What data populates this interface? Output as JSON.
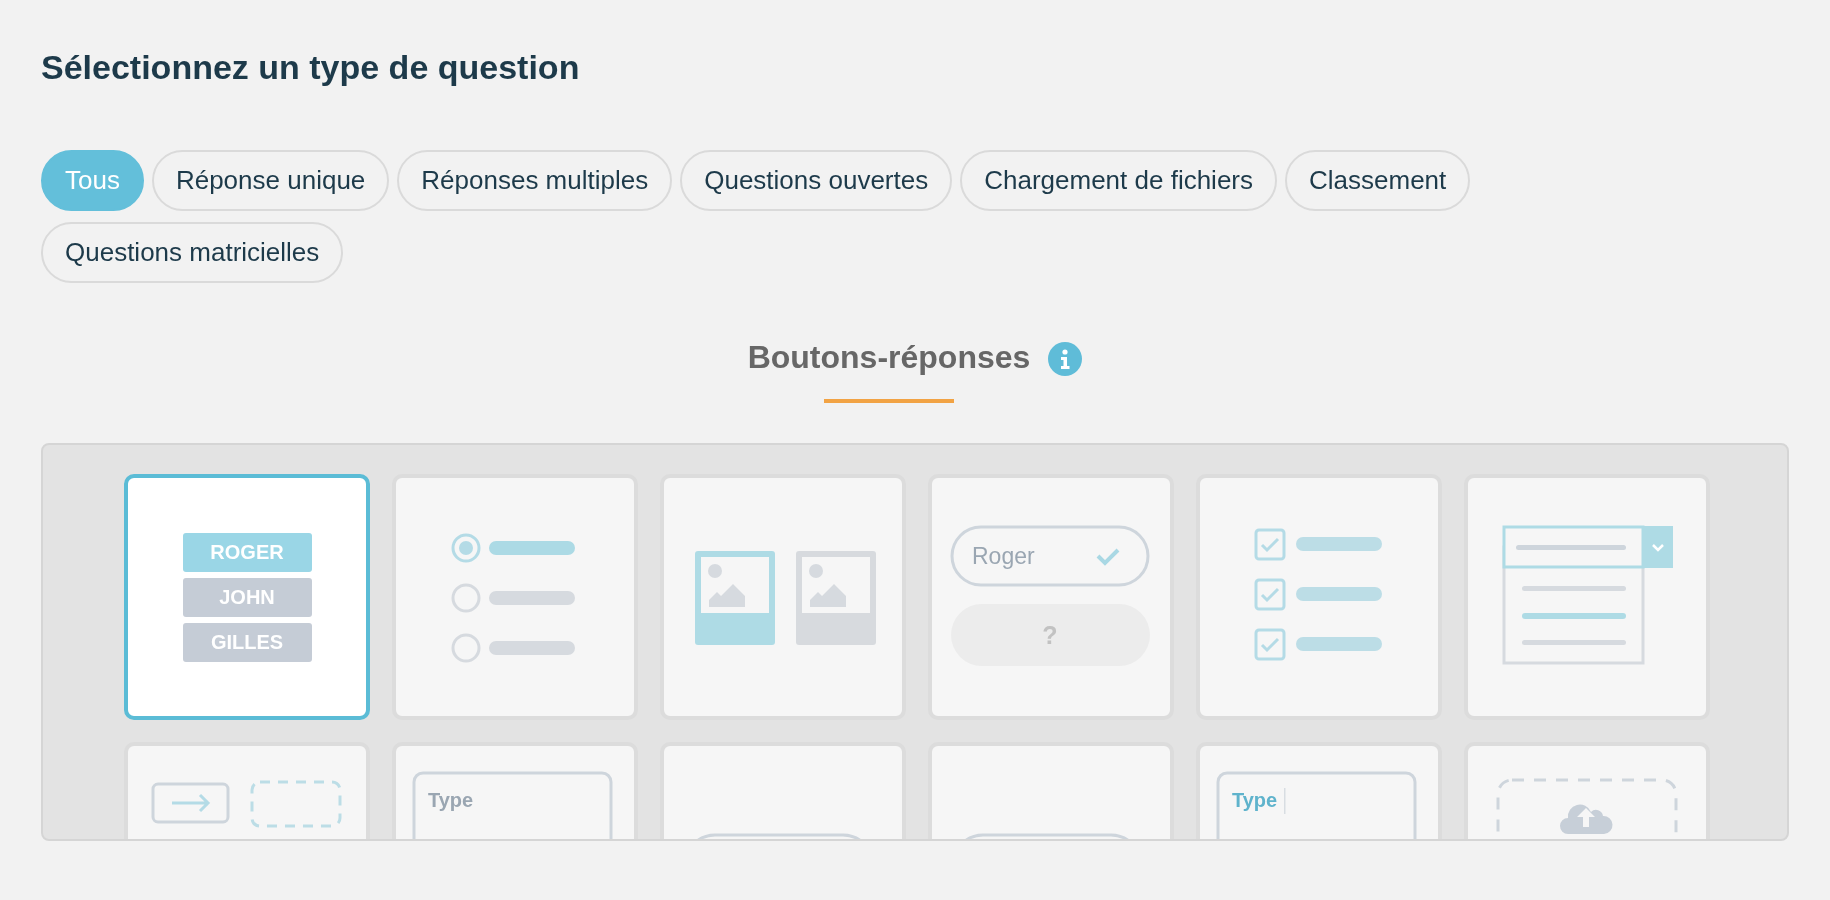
{
  "title": "Sélectionnez un type de question",
  "tabs": [
    {
      "label": "Tous",
      "selected": true
    },
    {
      "label": "Réponse unique",
      "selected": false
    },
    {
      "label": "Réponses multiples",
      "selected": false
    },
    {
      "label": "Questions ouvertes",
      "selected": false
    },
    {
      "label": "Chargement de fichiers",
      "selected": false
    },
    {
      "label": "Classement",
      "selected": false
    },
    {
      "label": "Questions matricielles",
      "selected": false
    }
  ],
  "section": {
    "title": "Boutons-réponses"
  },
  "tiles": [
    {
      "kind": "name-buttons",
      "selected": true,
      "options": [
        {
          "label": "ROGER",
          "selected": true
        },
        {
          "label": "JOHN",
          "selected": false
        },
        {
          "label": "GILLES",
          "selected": false
        }
      ]
    },
    {
      "kind": "radio",
      "selected": false
    },
    {
      "kind": "images",
      "selected": false
    },
    {
      "kind": "text-check",
      "selected": false,
      "value": "Roger",
      "hint": "?"
    },
    {
      "kind": "checkboxes",
      "selected": false
    },
    {
      "kind": "dropdown",
      "selected": false
    },
    {
      "kind": "drag",
      "selected": false
    },
    {
      "kind": "textarea",
      "selected": false,
      "focused": false,
      "text": "Type"
    },
    {
      "kind": "pill",
      "selected": false
    },
    {
      "kind": "pill",
      "selected": false
    },
    {
      "kind": "textarea",
      "selected": false,
      "focused": true,
      "text": "Type"
    },
    {
      "kind": "upload",
      "selected": false
    }
  ]
}
